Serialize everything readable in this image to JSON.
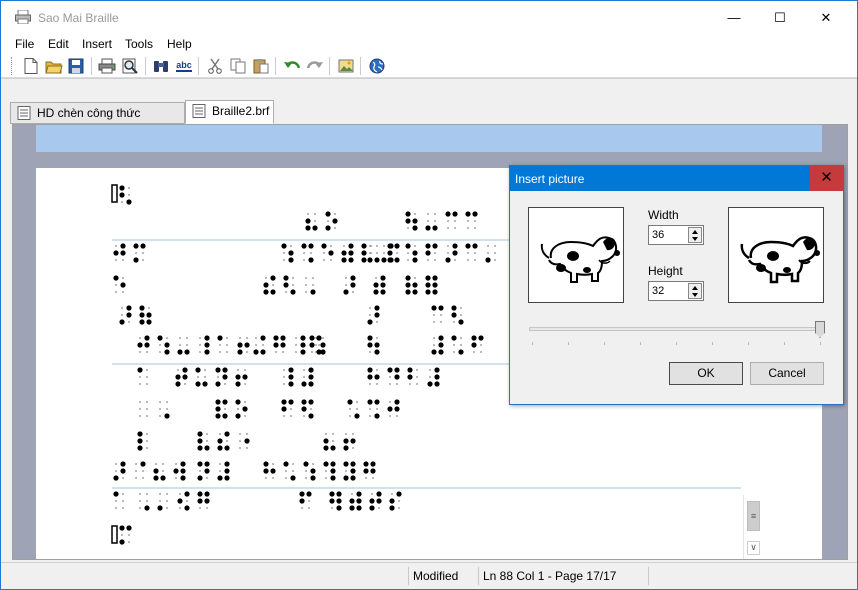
{
  "window": {
    "title": "Sao Mai Braille",
    "minimize": "—",
    "maximize": "☐",
    "close": "✕"
  },
  "menu": [
    "File",
    "Edit",
    "Insert",
    "Tools",
    "Help"
  ],
  "toolbar": {
    "icons": [
      "new-icon",
      "open-folder-icon",
      "save-icon",
      "print-icon",
      "print-preview-icon",
      "find-icon",
      "spell-check-icon",
      "cut-icon",
      "copy-icon",
      "paste-icon",
      "undo-icon",
      "redo-icon",
      "insert-picture-icon",
      "globe-icon"
    ],
    "spell_label": "abc"
  },
  "tabs": [
    {
      "label": "HD chèn công thức Toán.smd",
      "active": false
    },
    {
      "label": "Braille2.brf",
      "active": true
    }
  ],
  "statusbar": {
    "modified": "Modified",
    "position": "Ln 88 Col 1 - Page 17/17"
  },
  "dialog": {
    "title": "Insert picture",
    "close": "✕",
    "width_label": "Width",
    "width_value": "36",
    "height_label": "Height",
    "height_value": "32",
    "slider_value": 1.0,
    "ok": "OK",
    "cancel": "Cancel"
  },
  "colors": {
    "titlebar_accent": "#0078d7",
    "doc_background": "#9ea4b5",
    "ruler": "#a8c8ee",
    "dialog_close": "#c53a3a"
  }
}
